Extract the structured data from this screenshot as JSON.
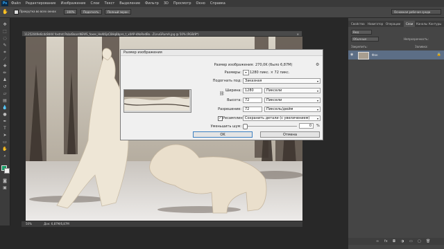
{
  "app": {
    "logo": "Ps"
  },
  "menu": [
    "Файл",
    "Редактирование",
    "Изображение",
    "Слои",
    "Текст",
    "Выделение",
    "Фильтр",
    "3D",
    "Просмотр",
    "Окно",
    "Справка"
  ],
  "options": {
    "scroll_all": "Прокрутка во всех окнах",
    "zoom_100": "100%",
    "fit": "Подогнать",
    "fill": "Полный экран",
    "workspace": "Основная рабочая среда"
  },
  "document": {
    "tab": "11252049e6cdc8d44 foxtrot PolarBearsNEWS_foxes_HeAl6jsC8Hq8bpro_t_x0AP-kNoRodBo...ZLnuGRumA.jpg @ 50% (RGB/8*)",
    "zoom": "50%",
    "status": "Док: 6,87M/6,87M"
  },
  "panels": {
    "tabs_top": [
      "Свойства",
      "Навигатор",
      "Операции",
      "Слои",
      "Каналы",
      "Контуры"
    ],
    "active_tab": "Слои",
    "kind": "Вид",
    "blend": "Обычные",
    "opacity_label": "Непрозрачность:",
    "lock_label": "Закрепить:",
    "fill_label": "Заливка:",
    "layer_name": "Фон"
  },
  "dialog": {
    "title": "Размер изображения",
    "size_label": "Размер изображения:",
    "size_value": "270,0K (было 6,87M)",
    "dims_label": "Размеры:",
    "dims_value": "1280 пикс. × 72 пикс.",
    "fit_label": "Подогнать под:",
    "fit_value": "Заказная",
    "width_label": "Ширина:",
    "width_value": "1280",
    "width_unit": "Пиксели",
    "height_label": "Высота:",
    "height_value": "72",
    "height_unit": "Пиксели",
    "res_label": "Разрешение:",
    "res_value": "72",
    "res_unit": "Пиксель/дюйм",
    "resample_label": "Ресамплинг:",
    "resample_value": "Сохранить детали (с увеличением)",
    "noise_label": "Уменьшить шум:",
    "noise_value": "0",
    "noise_unit": "%",
    "ok": "OK",
    "cancel": "Отмена"
  },
  "colors": {
    "accent": "#2fa3f0",
    "dialog_bg": "#f0f0f0",
    "canvas": "#282828"
  }
}
